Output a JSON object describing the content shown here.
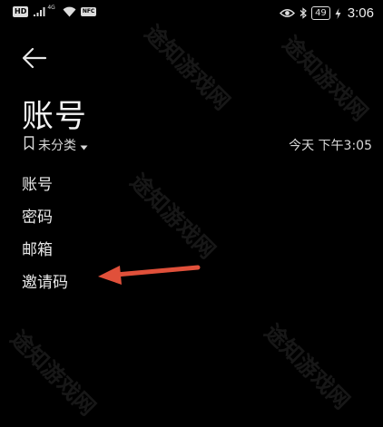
{
  "status_bar": {
    "hd_label": "HD",
    "network_label": "4G",
    "nfc_label": "NFC",
    "battery_level": "49",
    "time": "3:06"
  },
  "header": {
    "back_icon": "arrow-left-icon",
    "title": "账号"
  },
  "meta": {
    "category": "未分类",
    "timestamp": "今天 下午3:05"
  },
  "fields": [
    {
      "label": "账号"
    },
    {
      "label": "密码"
    },
    {
      "label": "邮箱"
    },
    {
      "label": "邀请码"
    }
  ],
  "annotation": {
    "arrow_color": "#e0503a",
    "arrow_icon": "red-arrow-pointer-icon"
  },
  "watermark": {
    "text": "途知游戏网"
  }
}
